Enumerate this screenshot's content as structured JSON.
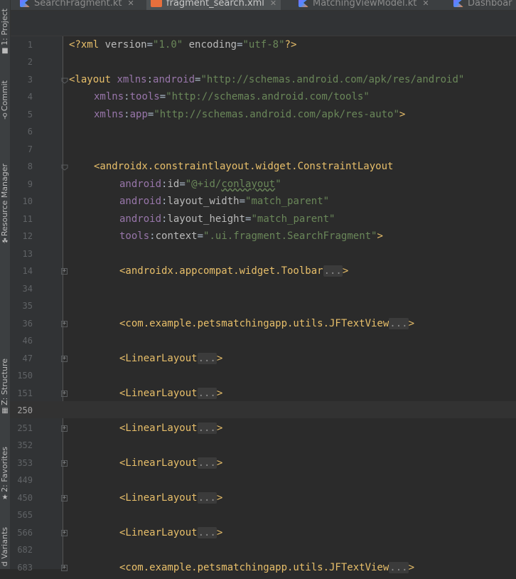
{
  "tabs": [
    {
      "label": "SearchFragment.kt",
      "icon": "kotlin-file-icon"
    },
    {
      "label": "fragment_search.xml",
      "icon": "xml-file-icon",
      "active": true
    },
    {
      "label": "MatchingViewModel.kt",
      "icon": "kotlin-file-icon"
    },
    {
      "label": "Dashboar",
      "icon": "kotlin-file-icon"
    }
  ],
  "left_tools": [
    {
      "label": "1: Project",
      "icon": "folder-icon"
    },
    {
      "label": "Commit",
      "icon": "commit-icon"
    },
    {
      "label": "Resource Manager",
      "icon": "resource-manager-icon"
    },
    {
      "label": "Z: Structure",
      "icon": "structure-icon"
    },
    {
      "label": "2: Favorites",
      "icon": "star-icon"
    },
    {
      "label": "d Variants",
      "icon": "variants-icon"
    }
  ],
  "current_line": "250",
  "lines": [
    {
      "num": "1"
    },
    {
      "num": "2"
    },
    {
      "num": "3"
    },
    {
      "num": "4"
    },
    {
      "num": "5"
    },
    {
      "num": "6"
    },
    {
      "num": "7"
    },
    {
      "num": "8"
    },
    {
      "num": "9"
    },
    {
      "num": "10"
    },
    {
      "num": "11"
    },
    {
      "num": "12"
    },
    {
      "num": "13"
    },
    {
      "num": "14"
    },
    {
      "num": "34"
    },
    {
      "num": "35"
    },
    {
      "num": "36"
    },
    {
      "num": "46"
    },
    {
      "num": "47"
    },
    {
      "num": "150"
    },
    {
      "num": "151"
    },
    {
      "num": "250"
    },
    {
      "num": "251"
    },
    {
      "num": "352"
    },
    {
      "num": "353"
    },
    {
      "num": "449"
    },
    {
      "num": "450"
    },
    {
      "num": "565"
    },
    {
      "num": "566"
    },
    {
      "num": "682"
    },
    {
      "num": "683"
    }
  ],
  "code": {
    "l1_open": "<?xml ",
    "l1_a1": "version",
    "l1_v1": "\"1.0\"",
    "l1_a2": "encoding",
    "l1_v2": "\"utf-8\"",
    "l1_close": "?>",
    "l3_tag": "<layout ",
    "l3_ns": "xmlns",
    "l3_attr": "android",
    "l3_val": "\"http://schemas.android.com/apk/res/android\"",
    "l4_ns": "xmlns",
    "l4_attr": "tools",
    "l4_val": "\"http://schemas.android.com/tools\"",
    "l5_ns": "xmlns",
    "l5_attr": "app",
    "l5_val": "\"http://schemas.android.com/apk/res-auto\"",
    "l5_close": ">",
    "l8_tag": "<androidx.constraintlayout.widget.ConstraintLayout",
    "l9_ns": "android",
    "l9_attr": "id",
    "l9_val_a": "\"@+id/",
    "l9_val_b": "conlayout",
    "l9_val_c": "\"",
    "l10_ns": "android",
    "l10_attr": "layout_width",
    "l10_val": "\"match_parent\"",
    "l11_ns": "android",
    "l11_attr": "layout_height",
    "l11_val": "\"match_parent\"",
    "l12_ns": "tools",
    "l12_attr": "context",
    "l12_val": "\".ui.fragment.SearchFragment\"",
    "l12_close": ">",
    "l14_tag": "<androidx.appcompat.widget.Toolbar",
    "l36_tag": "<com.example.petsmatchingapp.utils.JFTextView",
    "l47_tag": "<LinearLayout",
    "l151_tag": "<LinearLayout",
    "l251_tag": "<LinearLayout",
    "l353_tag": "<LinearLayout",
    "l450_tag": "<LinearLayout",
    "l566_tag": "<LinearLayout",
    "l683_tag": "<com.example.petsmatchingapp.utils.JFTextView",
    "folded": "...",
    "fold_close": ">"
  }
}
